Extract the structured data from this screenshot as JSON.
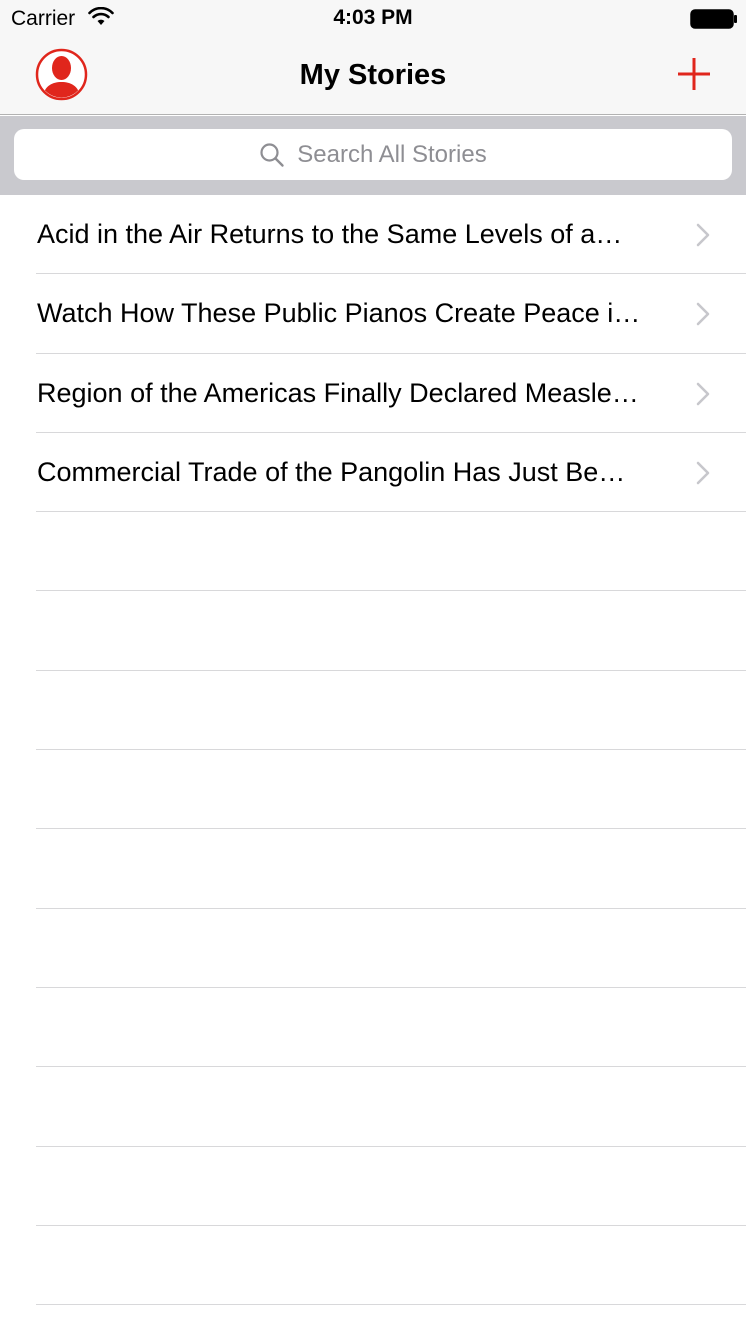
{
  "status_bar": {
    "carrier": "Carrier",
    "time": "4:03 PM",
    "wifi_icon": "wifi-icon",
    "battery_icon": "battery-icon"
  },
  "nav_bar": {
    "title": "My Stories",
    "left_icon": "profile-avatar-icon",
    "right_icon": "plus-icon"
  },
  "search": {
    "placeholder": "Search All Stories",
    "icon": "search-icon"
  },
  "stories": [
    {
      "title": "Acid in the Air Returns to the Same Levels of a…"
    },
    {
      "title": "Watch How These Public Pianos Create Peace i…"
    },
    {
      "title": "Region of the Americas Finally Declared Measle…"
    },
    {
      "title": "Commercial Trade of the Pangolin Has Just Be…"
    }
  ],
  "colors": {
    "accent": "#e0261c",
    "bar_background": "#f7f7f7",
    "search_background": "#c9c9ce",
    "separator": "#d8d8da",
    "placeholder": "#8e8e93",
    "chevron": "#c7c7cc"
  }
}
